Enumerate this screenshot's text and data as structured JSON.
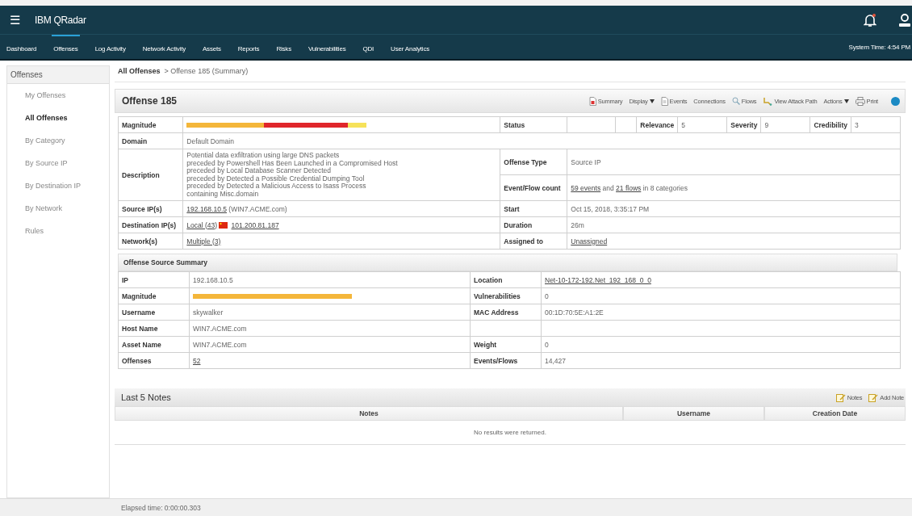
{
  "app": {
    "title": "IBM QRadar",
    "menu_icon": "☰"
  },
  "nav": {
    "tabs": [
      {
        "label": "Dashboard",
        "selected": false
      },
      {
        "label": "Offenses",
        "selected": true
      },
      {
        "label": "Log Activity",
        "selected": false
      },
      {
        "label": "Network Activity",
        "selected": false
      },
      {
        "label": "Assets",
        "selected": false
      },
      {
        "label": "Reports",
        "selected": false
      },
      {
        "label": "Risks",
        "selected": false
      },
      {
        "label": "Vulnerabilities",
        "selected": false
      },
      {
        "label": "QDI",
        "selected": false
      },
      {
        "label": "User Analytics",
        "selected": false
      }
    ],
    "system_time": "System Time: 4:54 PM"
  },
  "sidebar": {
    "title": "Offenses",
    "items": [
      {
        "label": "My Offenses",
        "selected": false
      },
      {
        "label": "All Offenses",
        "selected": true
      },
      {
        "label": "By Category",
        "selected": false
      },
      {
        "label": "By Source IP",
        "selected": false
      },
      {
        "label": "By Destination IP",
        "selected": false
      },
      {
        "label": "By Network",
        "selected": false
      },
      {
        "label": "Rules",
        "selected": false
      }
    ]
  },
  "breadcrumb": {
    "link": "All Offenses",
    "current": "> Offense 185 (Summary)"
  },
  "offense": {
    "title": "Offense 185",
    "toolbar": [
      {
        "label": "Summary",
        "kind": "icon-button"
      },
      {
        "label": "Display",
        "kind": "menu"
      },
      {
        "label": "Events",
        "kind": "icon-button"
      },
      {
        "label": "Connections",
        "kind": "plain"
      },
      {
        "label": "Flows",
        "kind": "icon-button"
      },
      {
        "label": "View Attack Path",
        "kind": "icon-button"
      },
      {
        "label": "Actions",
        "kind": "menu"
      },
      {
        "label": "Print",
        "kind": "icon-button"
      }
    ],
    "magnitude": {
      "label": "Magnitude",
      "segments": [
        {
          "color": "#f4b63a"
        },
        {
          "color": "#e0262b"
        },
        {
          "color": "#f6e25a"
        }
      ]
    },
    "status": {
      "label": "Status"
    },
    "scores": [
      {
        "label": "Relevance",
        "value": "5"
      },
      {
        "label": "Severity",
        "value": "9"
      },
      {
        "label": "Credibility",
        "value": "3"
      }
    ],
    "domain": {
      "label": "Domain",
      "value": "Default Domain"
    },
    "description": {
      "label": "Description",
      "lines": [
        "Potential data exfiltration using large DNS packets",
        "preceded by Powershell Has Been Launched in a Compromised Host",
        "preceded by Local Database Scanner Detected",
        "preceded by Detected a Possible Credential Dumping Tool",
        "preceded by Detected a Malicious Access to Isass Process",
        "containing Misc.domain"
      ]
    },
    "offense_type": {
      "label": "Offense Type",
      "value": "Source IP"
    },
    "event_flow_count": {
      "label": "Event/Flow count",
      "parts": [
        {
          "kind": "link",
          "text": "59 events"
        },
        {
          "kind": "text",
          "text": "and"
        },
        {
          "kind": "link",
          "text": "21 flows"
        },
        {
          "kind": "text",
          "text": "in 8 categories"
        }
      ]
    },
    "rows": [
      {
        "label": "Source IP(s)",
        "parts": [
          {
            "kind": "link",
            "text": "192.168.10.5"
          },
          {
            "kind": "text",
            "text": "(WIN7.ACME.com)"
          }
        ],
        "right_label": "Start",
        "right_parts": [
          {
            "kind": "text",
            "text": "Oct 15, 2018, 3:35:17 PM"
          }
        ]
      },
      {
        "label": "Destination IP(s)",
        "parts": [
          {
            "kind": "link",
            "text": "Local (43)"
          },
          {
            "kind": "flag"
          },
          {
            "kind": "link",
            "text": "101.200.81.187"
          }
        ],
        "right_label": "Duration",
        "right_parts": [
          {
            "kind": "text",
            "text": "26m"
          }
        ]
      },
      {
        "label": "Network(s)",
        "parts": [
          {
            "kind": "link",
            "text": "Multiple (3)"
          }
        ],
        "right_label": "Assigned to",
        "right_parts": [
          {
            "kind": "link",
            "text": "Unassigned"
          }
        ]
      }
    ]
  },
  "source_summary": {
    "title": "Offense Source Summary",
    "rows": [
      {
        "label": "IP",
        "kind": "text",
        "value": "192.168.10.5",
        "right_label": "Location",
        "right_parts": [
          {
            "kind": "link",
            "text": "Net-10-172-192.Net_192_168_0_0"
          }
        ]
      },
      {
        "label": "Magnitude",
        "kind": "bar",
        "level": 0.58,
        "right_label": "Vulnerabilities",
        "right_parts": [
          {
            "kind": "text",
            "text": "0"
          }
        ]
      },
      {
        "label": "Username",
        "kind": "text",
        "value": "skywalker",
        "right_label": "MAC Address",
        "right_parts": [
          {
            "kind": "text",
            "text": "00:1D:70:5E:A1:2E"
          }
        ]
      },
      {
        "label": "Host Name",
        "kind": "text",
        "value": "WIN7.ACME.com"
      },
      {
        "label": "Asset Name",
        "kind": "text",
        "value": "WIN7.ACME.com",
        "right_label": "Weight",
        "right_parts": [
          {
            "kind": "text",
            "text": "0"
          }
        ]
      },
      {
        "label": "Offenses",
        "kind": "link",
        "value": "52",
        "right_label": "Events/Flows",
        "right_parts": [
          {
            "kind": "text",
            "text": "14,427"
          }
        ]
      }
    ]
  },
  "notes": {
    "title": "Last 5 Notes",
    "buttons": [
      "Notes",
      "Add Note"
    ],
    "columns": [
      "Notes",
      "Username",
      "Creation Date"
    ],
    "empty_message": "No results were returned."
  },
  "footer": {
    "elapsed": "Elapsed time: 0:00:00.303"
  }
}
